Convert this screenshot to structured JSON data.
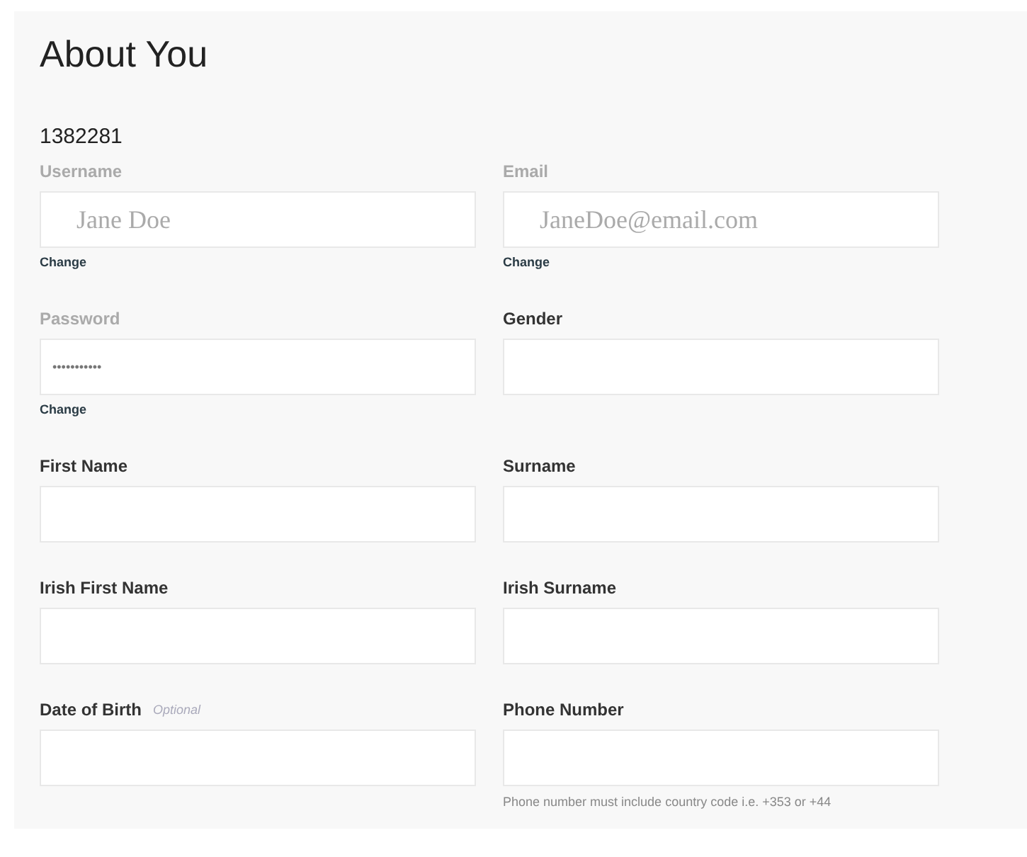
{
  "title": "About You",
  "account_id": "1382281",
  "fields": [
    {
      "label": "Username",
      "disabled": true,
      "value": "Jane Doe",
      "link": "Change"
    },
    {
      "label": "Email",
      "disabled": true,
      "value": "JaneDoe@email.com",
      "link": "Change"
    },
    {
      "label": "Password",
      "disabled": true,
      "value": "•••••••••••",
      "kind": "password",
      "link": "Change"
    },
    {
      "label": "Gender",
      "disabled": false
    },
    {
      "label": "First Name",
      "disabled": false
    },
    {
      "label": "Surname",
      "disabled": false
    },
    {
      "label": "Irish First Name",
      "disabled": false
    },
    {
      "label": "Irish Surname",
      "disabled": false
    },
    {
      "label": "Date of Birth",
      "disabled": false,
      "note": "Optional"
    },
    {
      "label": "Phone Number",
      "disabled": false,
      "hint": "Phone number must include country code i.e. +353 or +44"
    }
  ]
}
